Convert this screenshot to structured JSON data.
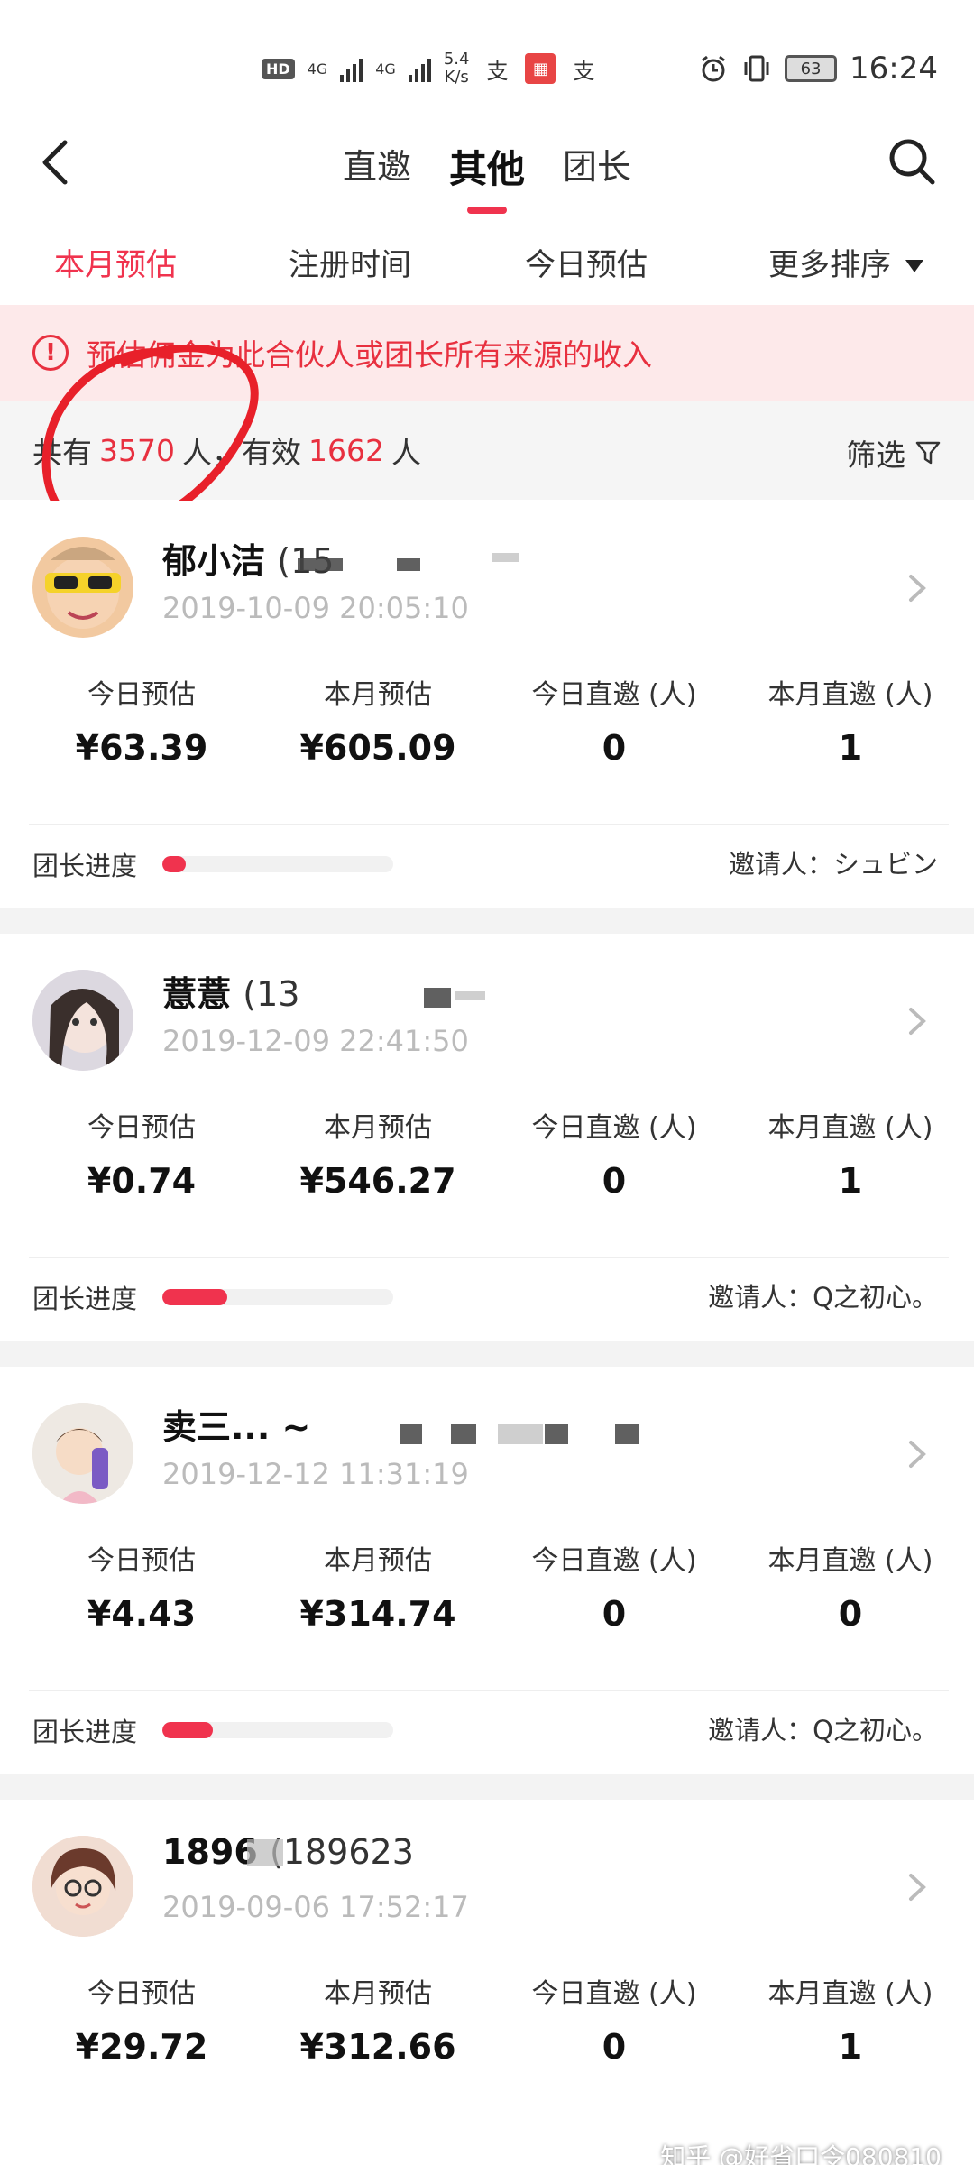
{
  "status_bar": {
    "badge": "HD",
    "net1": "4G",
    "net2": "4G",
    "speed_value": "5.4",
    "speed_unit": "K/s",
    "battery": "63",
    "time": "16:24"
  },
  "nav": {
    "tabs": [
      "直邀",
      "其他",
      "团长"
    ],
    "active_tab_index": 1
  },
  "sort": {
    "items": [
      "本月预估",
      "注册时间",
      "今日预估",
      "更多排序"
    ],
    "active_index": 0
  },
  "notice": {
    "text": "预估佣金为此合伙人或团长所有来源的收入"
  },
  "summary": {
    "prefix": "共有",
    "total": "3570",
    "mid": "人，有效",
    "valid": "1662",
    "suffix": "人",
    "filter_label": "筛选"
  },
  "stat_labels": [
    "今日预估",
    "本月预估",
    "今日直邀 (人)",
    "本月直邀 (人)"
  ],
  "progress_label": "团长进度",
  "inviter_prefix": "邀请人：",
  "members": [
    {
      "name": "郁小洁",
      "phone": "(15",
      "date": "2019-10-09 20:05:10",
      "today_est": "¥63.39",
      "month_est": "¥605.09",
      "today_invites": "0",
      "month_invites": "1",
      "progress": 0.1,
      "inviter": "シュビン"
    },
    {
      "name": "薏薏",
      "phone": "(13",
      "date": "2019-12-09 22:41:50",
      "today_est": "¥0.74",
      "month_est": "¥546.27",
      "today_invites": "0",
      "month_invites": "1",
      "progress": 0.28,
      "inviter": "Q之初心。"
    },
    {
      "name": "卖三... ~",
      "phone": "",
      "date": "2019-12-12 11:31:19",
      "today_est": "¥4.43",
      "month_est": "¥314.74",
      "today_invites": "0",
      "month_invites": "0",
      "progress": 0.22,
      "inviter": "Q之初心。"
    },
    {
      "name": "1896",
      "phone": "(189623",
      "date": "2019-09-06 17:52:17",
      "today_est": "¥29.72",
      "month_est": "¥312.66",
      "today_invites": "0",
      "month_invites": "1",
      "progress": 0.0,
      "inviter": ""
    }
  ],
  "watermark": "知乎 @好省口令080810",
  "colors": {
    "accent": "#f0334e",
    "notice_bg": "#fde9ea",
    "notice_text": "#e8303f"
  }
}
